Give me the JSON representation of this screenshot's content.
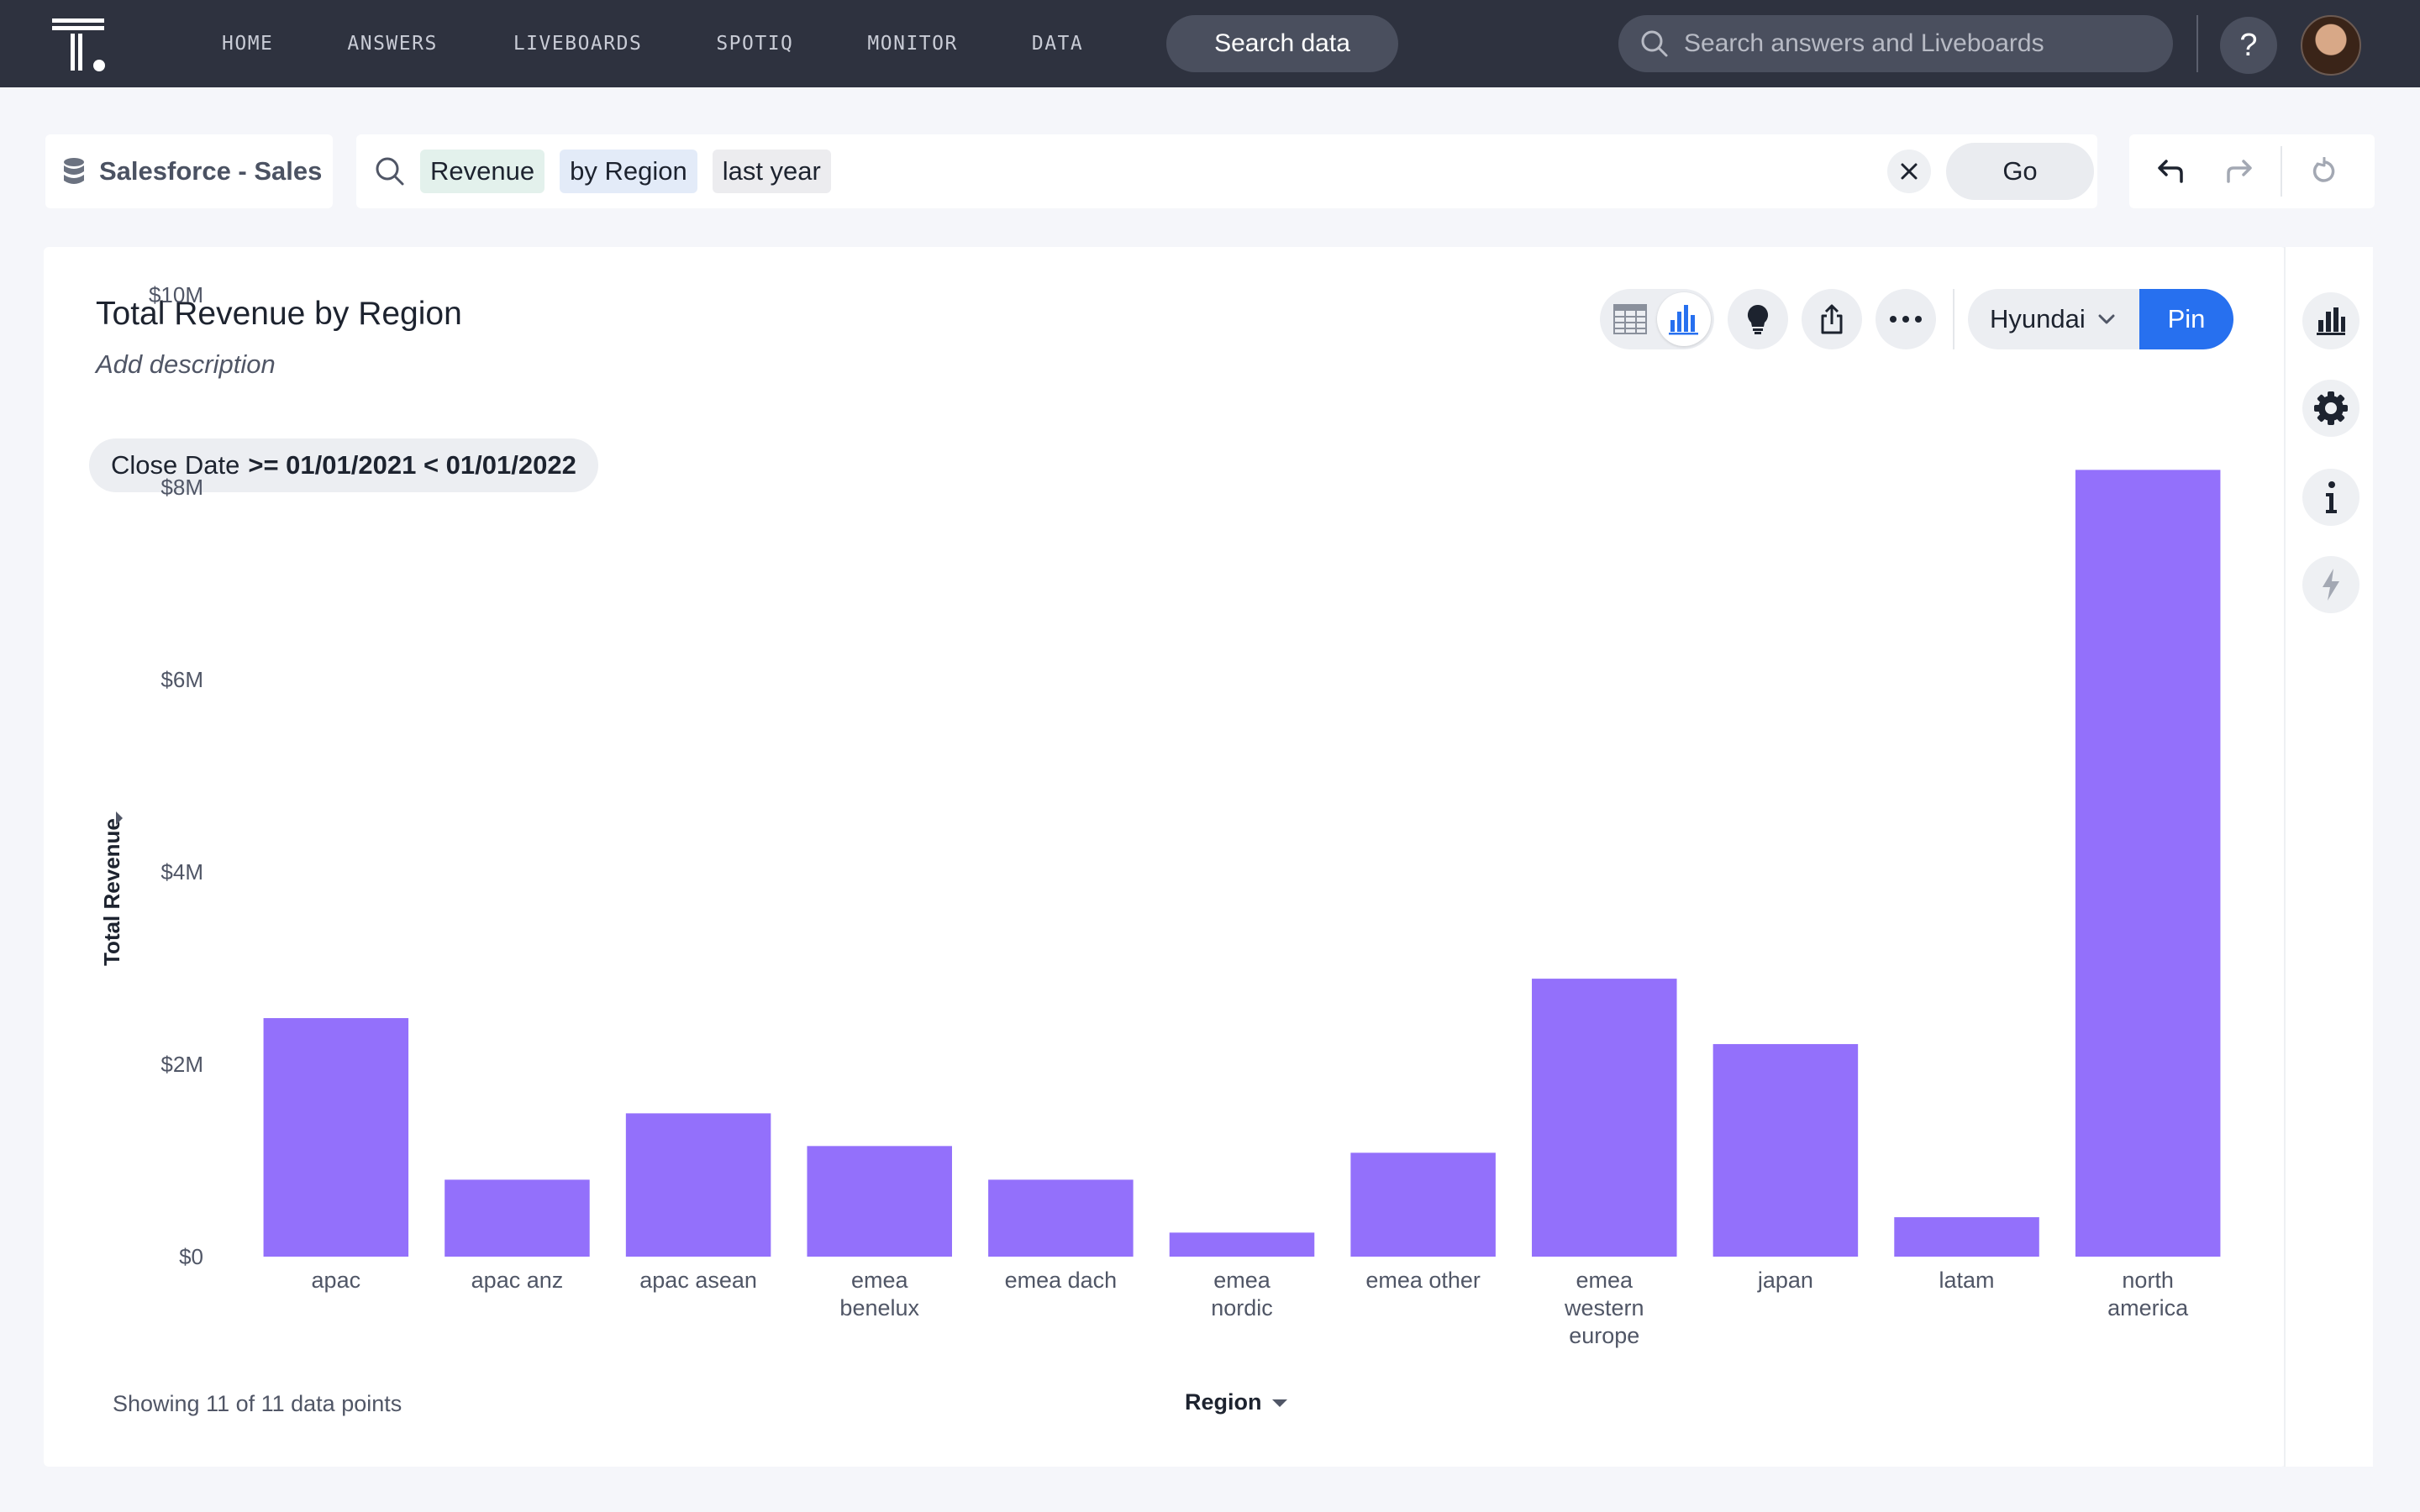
{
  "nav": {
    "items": [
      "HOME",
      "ANSWERS",
      "LIVEBOARDS",
      "SPOTIQ",
      "MONITOR",
      "DATA"
    ],
    "search_data_label": "Search data",
    "global_search_placeholder": "Search answers and Liveboards",
    "help_label": "?"
  },
  "search": {
    "datasource": "Salesforce - Sales",
    "tokens": [
      {
        "text": "Revenue",
        "kind": "measure"
      },
      {
        "text": "by Region",
        "kind": "attribute"
      },
      {
        "text": "last year",
        "kind": "keyword"
      }
    ],
    "go_label": "Go"
  },
  "answer": {
    "title": "Total Revenue by Region",
    "description_placeholder": "Add description",
    "filter_field": "Close Date",
    "filter_value": ">= 01/01/2021 < 01/01/2022",
    "org_label": "Hyundai",
    "pin_label": "Pin",
    "footer": "Showing 11 of 11 data points"
  },
  "colors": {
    "bar": "#9370fb",
    "pin": "#2770ef",
    "topbar": "#2e323f"
  },
  "chart_data": {
    "type": "bar",
    "ylabel": "Total Revenue",
    "xlabel": "Region",
    "ylim": [
      0,
      10000000
    ],
    "yticks": [
      {
        "value": 0,
        "label": "$0"
      },
      {
        "value": 2000000,
        "label": "$2M"
      },
      {
        "value": 4000000,
        "label": "$4M"
      },
      {
        "value": 6000000,
        "label": "$6M"
      },
      {
        "value": 8000000,
        "label": "$8M"
      },
      {
        "value": 10000000,
        "label": "$10M"
      }
    ],
    "categories": [
      "apac",
      "apac anz",
      "apac asean",
      "emea benelux",
      "emea dach",
      "emea nordic",
      "emea other",
      "emea western europe",
      "japan",
      "latam",
      "north america"
    ],
    "category_lines": [
      [
        "apac"
      ],
      [
        "apac anz"
      ],
      [
        "apac asean"
      ],
      [
        "emea",
        "benelux"
      ],
      [
        "emea dach"
      ],
      [
        "emea",
        "nordic"
      ],
      [
        "emea other"
      ],
      [
        "emea",
        "western",
        "europe"
      ],
      [
        "japan"
      ],
      [
        "latam"
      ],
      [
        "north",
        "america"
      ]
    ],
    "values": [
      2480000,
      800000,
      1490000,
      1150000,
      800000,
      250000,
      1080000,
      2890000,
      2210000,
      410000,
      8180000
    ],
    "grid": false
  }
}
